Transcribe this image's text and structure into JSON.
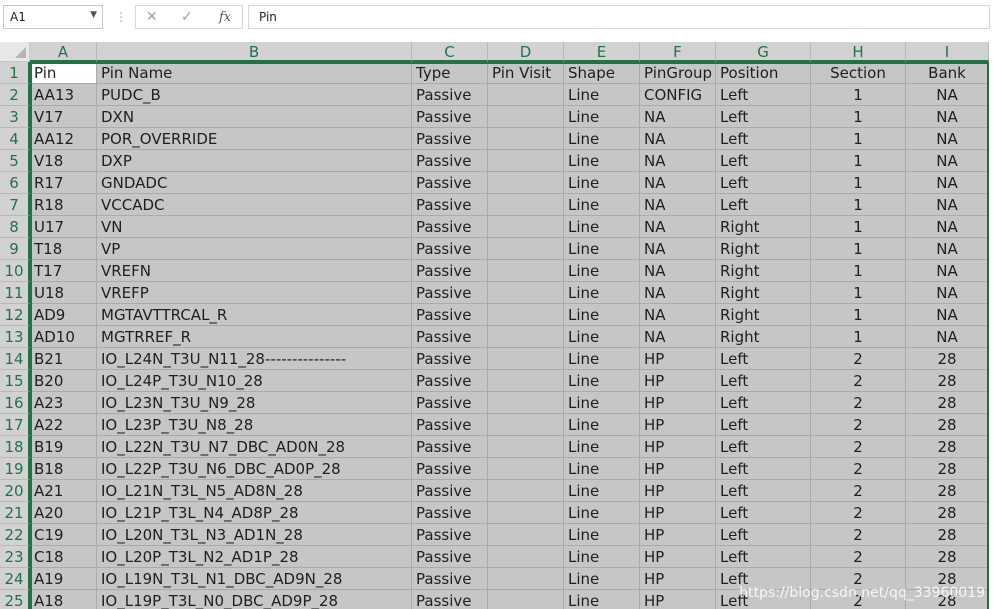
{
  "formula_bar": {
    "name_box": "A1",
    "cancel_glyph": "✕",
    "enter_glyph": "✓",
    "fx_label": "fx",
    "content": "Pin"
  },
  "columns": [
    "A",
    "B",
    "C",
    "D",
    "E",
    "F",
    "G",
    "H",
    "I"
  ],
  "rows": [
    [
      "1",
      "Pin",
      "Pin Name",
      "Type",
      "Pin Visit",
      "Shape",
      "PinGroup",
      "Position",
      "Section",
      "Bank"
    ],
    [
      "2",
      "AA13",
      "PUDC_B",
      "Passive",
      "",
      "Line",
      "CONFIG",
      "Left",
      "1",
      "NA"
    ],
    [
      "3",
      "V17",
      "DXN",
      "Passive",
      "",
      "Line",
      "NA",
      "Left",
      "1",
      "NA"
    ],
    [
      "4",
      "AA12",
      "POR_OVERRIDE",
      "Passive",
      "",
      "Line",
      "NA",
      "Left",
      "1",
      "NA"
    ],
    [
      "5",
      "V18",
      "DXP",
      "Passive",
      "",
      "Line",
      "NA",
      "Left",
      "1",
      "NA"
    ],
    [
      "6",
      "R17",
      "GNDADC",
      "Passive",
      "",
      "Line",
      "NA",
      "Left",
      "1",
      "NA"
    ],
    [
      "7",
      "R18",
      "VCCADC",
      "Passive",
      "",
      "Line",
      "NA",
      "Left",
      "1",
      "NA"
    ],
    [
      "8",
      "U17",
      "VN",
      "Passive",
      "",
      "Line",
      "NA",
      "Right",
      "1",
      "NA"
    ],
    [
      "9",
      "T18",
      "VP",
      "Passive",
      "",
      "Line",
      "NA",
      "Right",
      "1",
      "NA"
    ],
    [
      "10",
      "T17",
      "VREFN",
      "Passive",
      "",
      "Line",
      "NA",
      "Right",
      "1",
      "NA"
    ],
    [
      "11",
      "U18",
      "VREFP",
      "Passive",
      "",
      "Line",
      "NA",
      "Right",
      "1",
      "NA"
    ],
    [
      "12",
      "AD9",
      "MGTAVTTRCAL_R",
      "Passive",
      "",
      "Line",
      "NA",
      "Right",
      "1",
      "NA"
    ],
    [
      "13",
      "AD10",
      "MGTRREF_R",
      "Passive",
      "",
      "Line",
      "NA",
      "Right",
      "1",
      "NA"
    ],
    [
      "14",
      "B21",
      "IO_L24N_T3U_N11_28---------------",
      "Passive",
      "",
      "Line",
      "HP",
      "Left",
      "2",
      "28"
    ],
    [
      "15",
      "B20",
      "IO_L24P_T3U_N10_28",
      "Passive",
      "",
      "Line",
      "HP",
      "Left",
      "2",
      "28"
    ],
    [
      "16",
      "A23",
      "IO_L23N_T3U_N9_28",
      "Passive",
      "",
      "Line",
      "HP",
      "Left",
      "2",
      "28"
    ],
    [
      "17",
      "A22",
      "IO_L23P_T3U_N8_28",
      "Passive",
      "",
      "Line",
      "HP",
      "Left",
      "2",
      "28"
    ],
    [
      "18",
      "B19",
      "IO_L22N_T3U_N7_DBC_AD0N_28",
      "Passive",
      "",
      "Line",
      "HP",
      "Left",
      "2",
      "28"
    ],
    [
      "19",
      "B18",
      "IO_L22P_T3U_N6_DBC_AD0P_28",
      "Passive",
      "",
      "Line",
      "HP",
      "Left",
      "2",
      "28"
    ],
    [
      "20",
      "A21",
      "IO_L21N_T3L_N5_AD8N_28",
      "Passive",
      "",
      "Line",
      "HP",
      "Left",
      "2",
      "28"
    ],
    [
      "21",
      "A20",
      "IO_L21P_T3L_N4_AD8P_28",
      "Passive",
      "",
      "Line",
      "HP",
      "Left",
      "2",
      "28"
    ],
    [
      "22",
      "C19",
      "IO_L20N_T3L_N3_AD1N_28",
      "Passive",
      "",
      "Line",
      "HP",
      "Left",
      "2",
      "28"
    ],
    [
      "23",
      "C18",
      "IO_L20P_T3L_N2_AD1P_28",
      "Passive",
      "",
      "Line",
      "HP",
      "Left",
      "2",
      "28"
    ],
    [
      "24",
      "A19",
      "IO_L19N_T3L_N1_DBC_AD9N_28",
      "Passive",
      "",
      "Line",
      "HP",
      "Left",
      "2",
      "28"
    ],
    [
      "25",
      "A18",
      "IO_L19P_T3L_N0_DBC_AD9P_28",
      "Passive",
      "",
      "Line",
      "HP",
      "Left",
      "2",
      "28"
    ]
  ],
  "watermark": "https://blog.csdn.net/qq_33960019",
  "colors": {
    "accent": "#217346",
    "selection": "#c6c6c6"
  }
}
